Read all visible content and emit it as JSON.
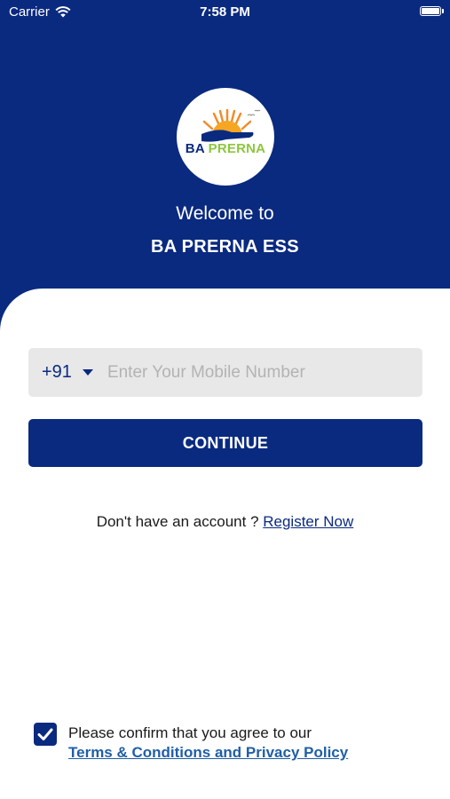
{
  "status_bar": {
    "carrier": "Carrier",
    "time": "7:58 PM"
  },
  "logo": {
    "brand_part1": "BA",
    "brand_part2": "PRERNA"
  },
  "header": {
    "welcome": "Welcome to",
    "app_name": "BA PRERNA ESS"
  },
  "form": {
    "country_code": "+91",
    "mobile_placeholder": "Enter Your Mobile Number",
    "mobile_value": "",
    "continue_label": "CONTINUE"
  },
  "register": {
    "prompt": "Don't have an account ? ",
    "link_label": "Register Now"
  },
  "terms": {
    "checked": true,
    "line1": "Please confirm that you agree to our",
    "link_label": "Terms & Conditions and Privacy Policy"
  },
  "colors": {
    "primary": "#0a2a80",
    "field_bg": "#e8e8e8",
    "logo_green": "#8dc63f",
    "link": "#1f5fa6"
  }
}
